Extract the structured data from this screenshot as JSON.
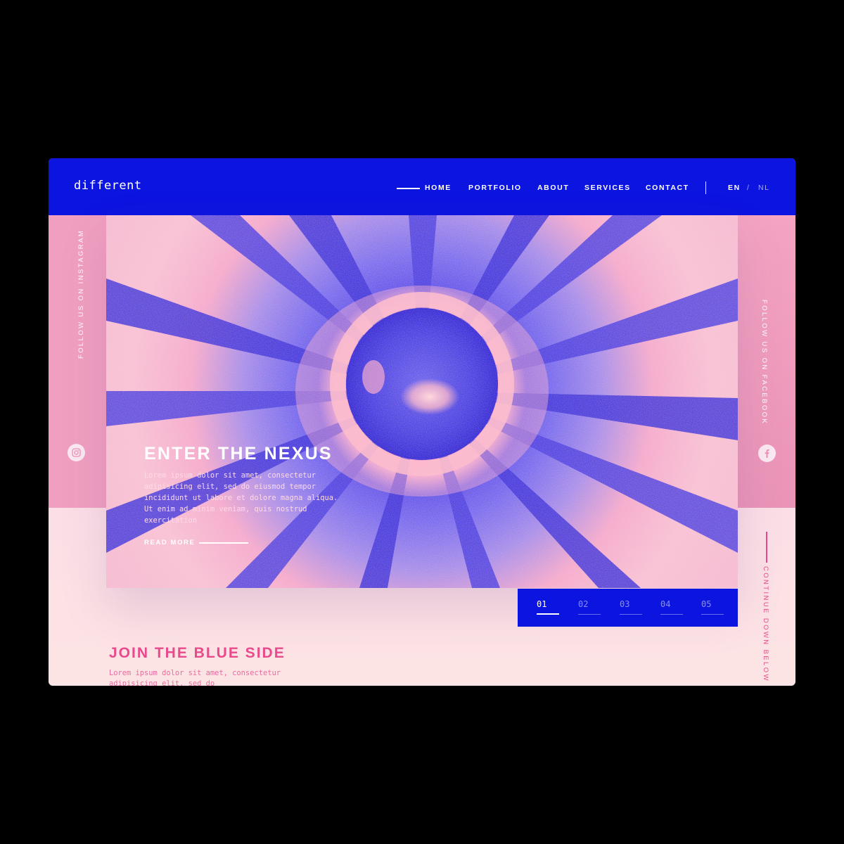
{
  "header": {
    "logo": "different",
    "nav": [
      {
        "label": "HOME",
        "active": true
      },
      {
        "label": "PORTFOLIO",
        "active": false
      },
      {
        "label": "ABOUT",
        "active": false
      },
      {
        "label": "SERVICES",
        "active": false
      },
      {
        "label": "CONTACT",
        "active": false
      }
    ],
    "languages": {
      "current": "EN",
      "separator": "/",
      "other": "NL"
    }
  },
  "sidebar_left": {
    "text": "FOLLOW US ON INSTAGRAM",
    "icon": "instagram-icon"
  },
  "sidebar_right": {
    "text": "FOLLOW US ON FACEBOOK",
    "icon": "facebook-icon",
    "scroll_hint": "CONTINUE DOWN BELOW"
  },
  "hero": {
    "title": "ENTER THE NEXUS",
    "body": "Lorem ipsum dolor sit amet, consectetur adipisicing elit, sed do eiusmod tempor incididunt ut labore et dolore magna aliqua. Ut enim ad minim veniam, quis nostrud exercitation",
    "cta": "READ MORE"
  },
  "pager": {
    "items": [
      "01",
      "02",
      "03",
      "04",
      "05"
    ],
    "active_index": 0
  },
  "section2": {
    "title": "JOIN THE BLUE SIDE",
    "body": "Lorem ipsum dolor sit amet, consectetur adipisicing elit, sed do"
  },
  "colors": {
    "brand_blue": "#0c14e0",
    "pink": "#f09fc0",
    "accent_pink": "#e84a8c"
  }
}
